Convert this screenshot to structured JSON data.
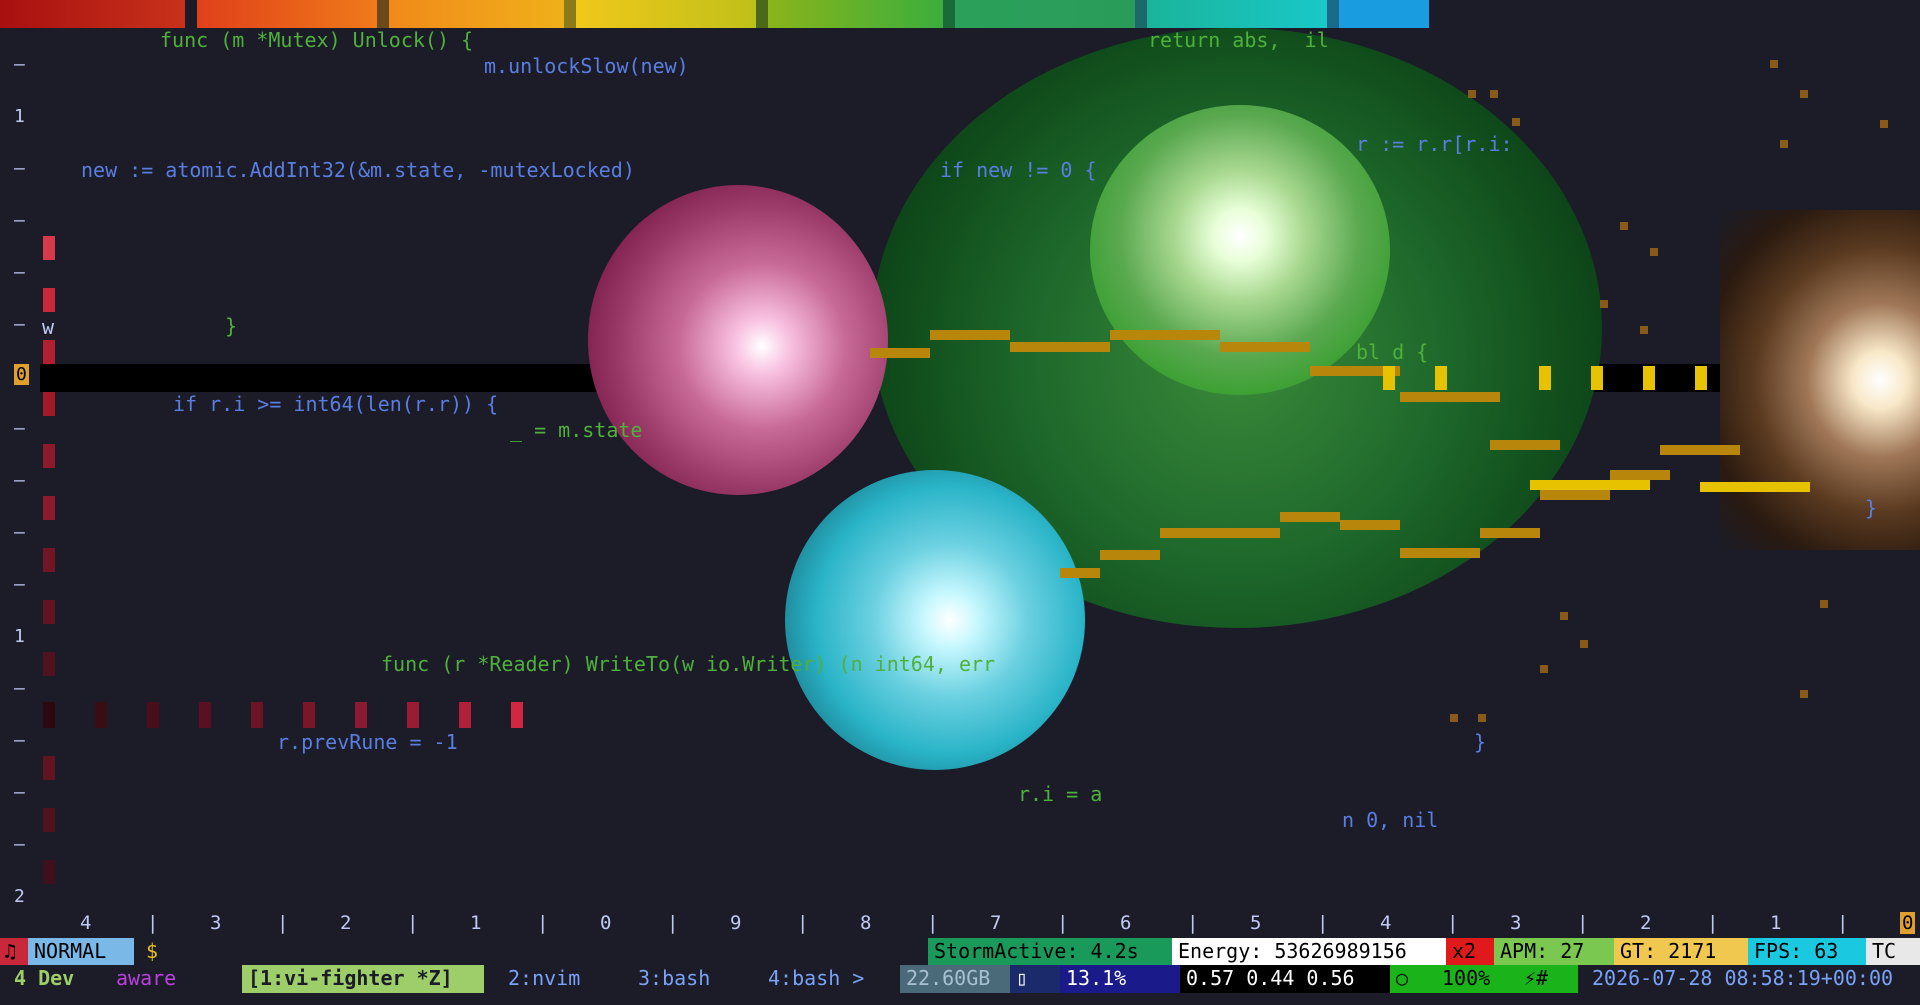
{
  "app": {
    "title": "vi-fighter"
  },
  "colors": {
    "background": "#1b1c28",
    "rainbow": [
      "#b8141a",
      "#c8321a",
      "#e8501a",
      "#f07a1a",
      "#f0a01a",
      "#f0c81a",
      "#c0c01a",
      "#8ab41a",
      "#3cae3c",
      "#2a9c5a",
      "#1ab49a",
      "#1ac8c8",
      "#1a9ce0"
    ],
    "orb_pink": "#e05a9a",
    "orb_green": "#2a8a3a",
    "orb_cyan": "#2ab4c8"
  },
  "gutter": {
    "numbers": [
      "—",
      "1",
      "—",
      "—",
      "—",
      "—",
      "—",
      "—",
      "—",
      "—",
      "—",
      "—",
      "1",
      "—",
      "—",
      "—",
      "—",
      "2"
    ],
    "cursor_line": "0",
    "w_marker": "w"
  },
  "code": [
    {
      "text": "func (m *Mutex) Unlock() {",
      "color": "green"
    },
    {
      "text": "m.unlockSlow(new)",
      "color": "blue"
    },
    {
      "text": "new := atomic.AddInt32(&m.state, -mutexLocked)",
      "color": "blue"
    },
    {
      "text": "}",
      "color": "green"
    },
    {
      "text": "if r.i >= int64(len(r.r)) {",
      "color": "blue"
    },
    {
      "text": "_ = m.state",
      "color": "green"
    },
    {
      "text": "func (r *Reader) WriteTo(w io.Writer) (n int64, err",
      "color": "green"
    },
    {
      "text": "r.prevRune = -1",
      "color": "blue"
    },
    {
      "text": "r.i = a",
      "color": "green"
    },
    {
      "text": "n 0, nil",
      "color": "blue"
    },
    {
      "text": "return abs,  il",
      "color": "green"
    },
    {
      "text": "if new != 0 {",
      "color": "blue"
    },
    {
      "text": "r := r.r[r.i:",
      "color": "blue"
    },
    {
      "text": "bl d {",
      "color": "green"
    },
    {
      "text": "}",
      "color": "blue"
    },
    {
      "text": "}",
      "color": "blue"
    }
  ],
  "ruler": [
    "4",
    "|",
    "3",
    "|",
    "2",
    "|",
    "1",
    "|",
    "0",
    "|",
    "9",
    "|",
    "8",
    "|",
    "7",
    "|",
    "6",
    "|",
    "5",
    "|",
    "4",
    "|",
    "3",
    "|",
    "2",
    "|",
    "1",
    "|",
    "0"
  ],
  "statusbar": {
    "music_icon": "♫",
    "mode": "NORMAL",
    "prompt": "$",
    "storm": "StormActive: 4.2s",
    "energy": "Energy: 53626989156",
    "multiplier": "x2",
    "apm": "APM: 27",
    "gt": "GT: 2171",
    "fps": "FPS: 63",
    "tc": "TC"
  },
  "tmux": {
    "session": "4 Dev",
    "aware": "aware",
    "windows": [
      "[1:vi-fighter *Z]",
      "2:nvim",
      "3:bash",
      "4:bash >"
    ],
    "disk": "22.60GB",
    "cpu": "13.1%",
    "load": "0.57 0.44 0.56",
    "battery": "100%",
    "power": "⚡#",
    "datetime": "2026-07-28 08:58:19+00:00"
  }
}
